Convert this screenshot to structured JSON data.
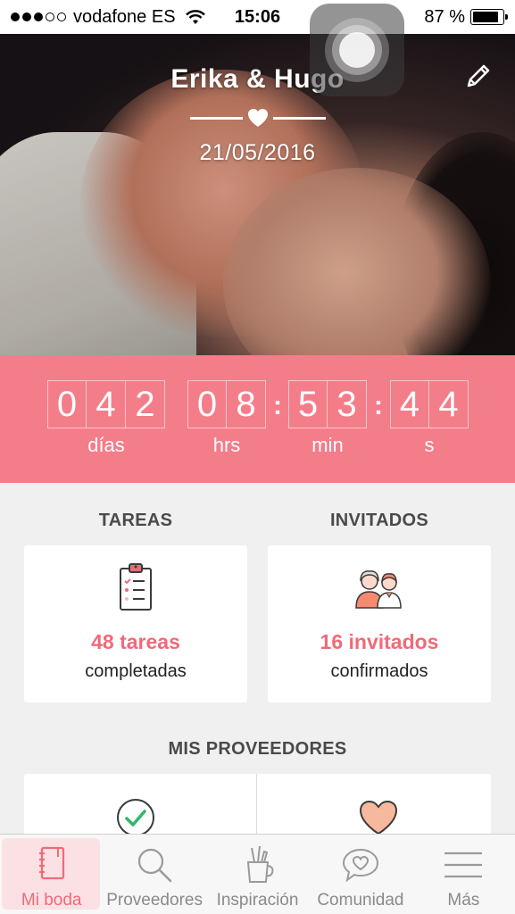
{
  "status_bar": {
    "carrier": "vodafone ES",
    "time": "15:06",
    "battery": "87 %",
    "battery_level": 0.87
  },
  "hero": {
    "couple_names": "Erika & Hugo",
    "wedding_date": "21/05/2016"
  },
  "countdown": {
    "days": [
      "0",
      "4",
      "2"
    ],
    "hours": [
      "0",
      "8"
    ],
    "minutes": [
      "5",
      "3"
    ],
    "seconds": [
      "4",
      "4"
    ],
    "separator": ":",
    "days_label": "días",
    "hours_label": "hrs",
    "minutes_label": "min",
    "seconds_label": "s"
  },
  "tasks": {
    "title": "TAREAS",
    "count": "48 tareas",
    "status": "completadas",
    "icon": "clipboard-checklist-icon"
  },
  "guests": {
    "title": "INVITADOS",
    "count": "16 invitados",
    "status": "confirmados",
    "icon": "guests-couple-icon"
  },
  "vendors": {
    "title": "MIS PROVEEDORES",
    "icons": [
      "check-circle-icon",
      "heart-icon"
    ]
  },
  "tab_bar": {
    "active_tab": "Mi boda",
    "tabs": [
      {
        "label": "Mi boda",
        "icon": "notebook-icon"
      },
      {
        "label": "Proveedores",
        "icon": "search-icon"
      },
      {
        "label": "Inspiración",
        "icon": "pencil-cup-icon"
      },
      {
        "label": "Comunidad",
        "icon": "chat-heart-icon"
      },
      {
        "label": "Más",
        "icon": "menu-icon"
      }
    ]
  },
  "colors": {
    "accent": "#f47d8a",
    "accent_text": "#f06a78",
    "background": "#f0f0f0"
  }
}
